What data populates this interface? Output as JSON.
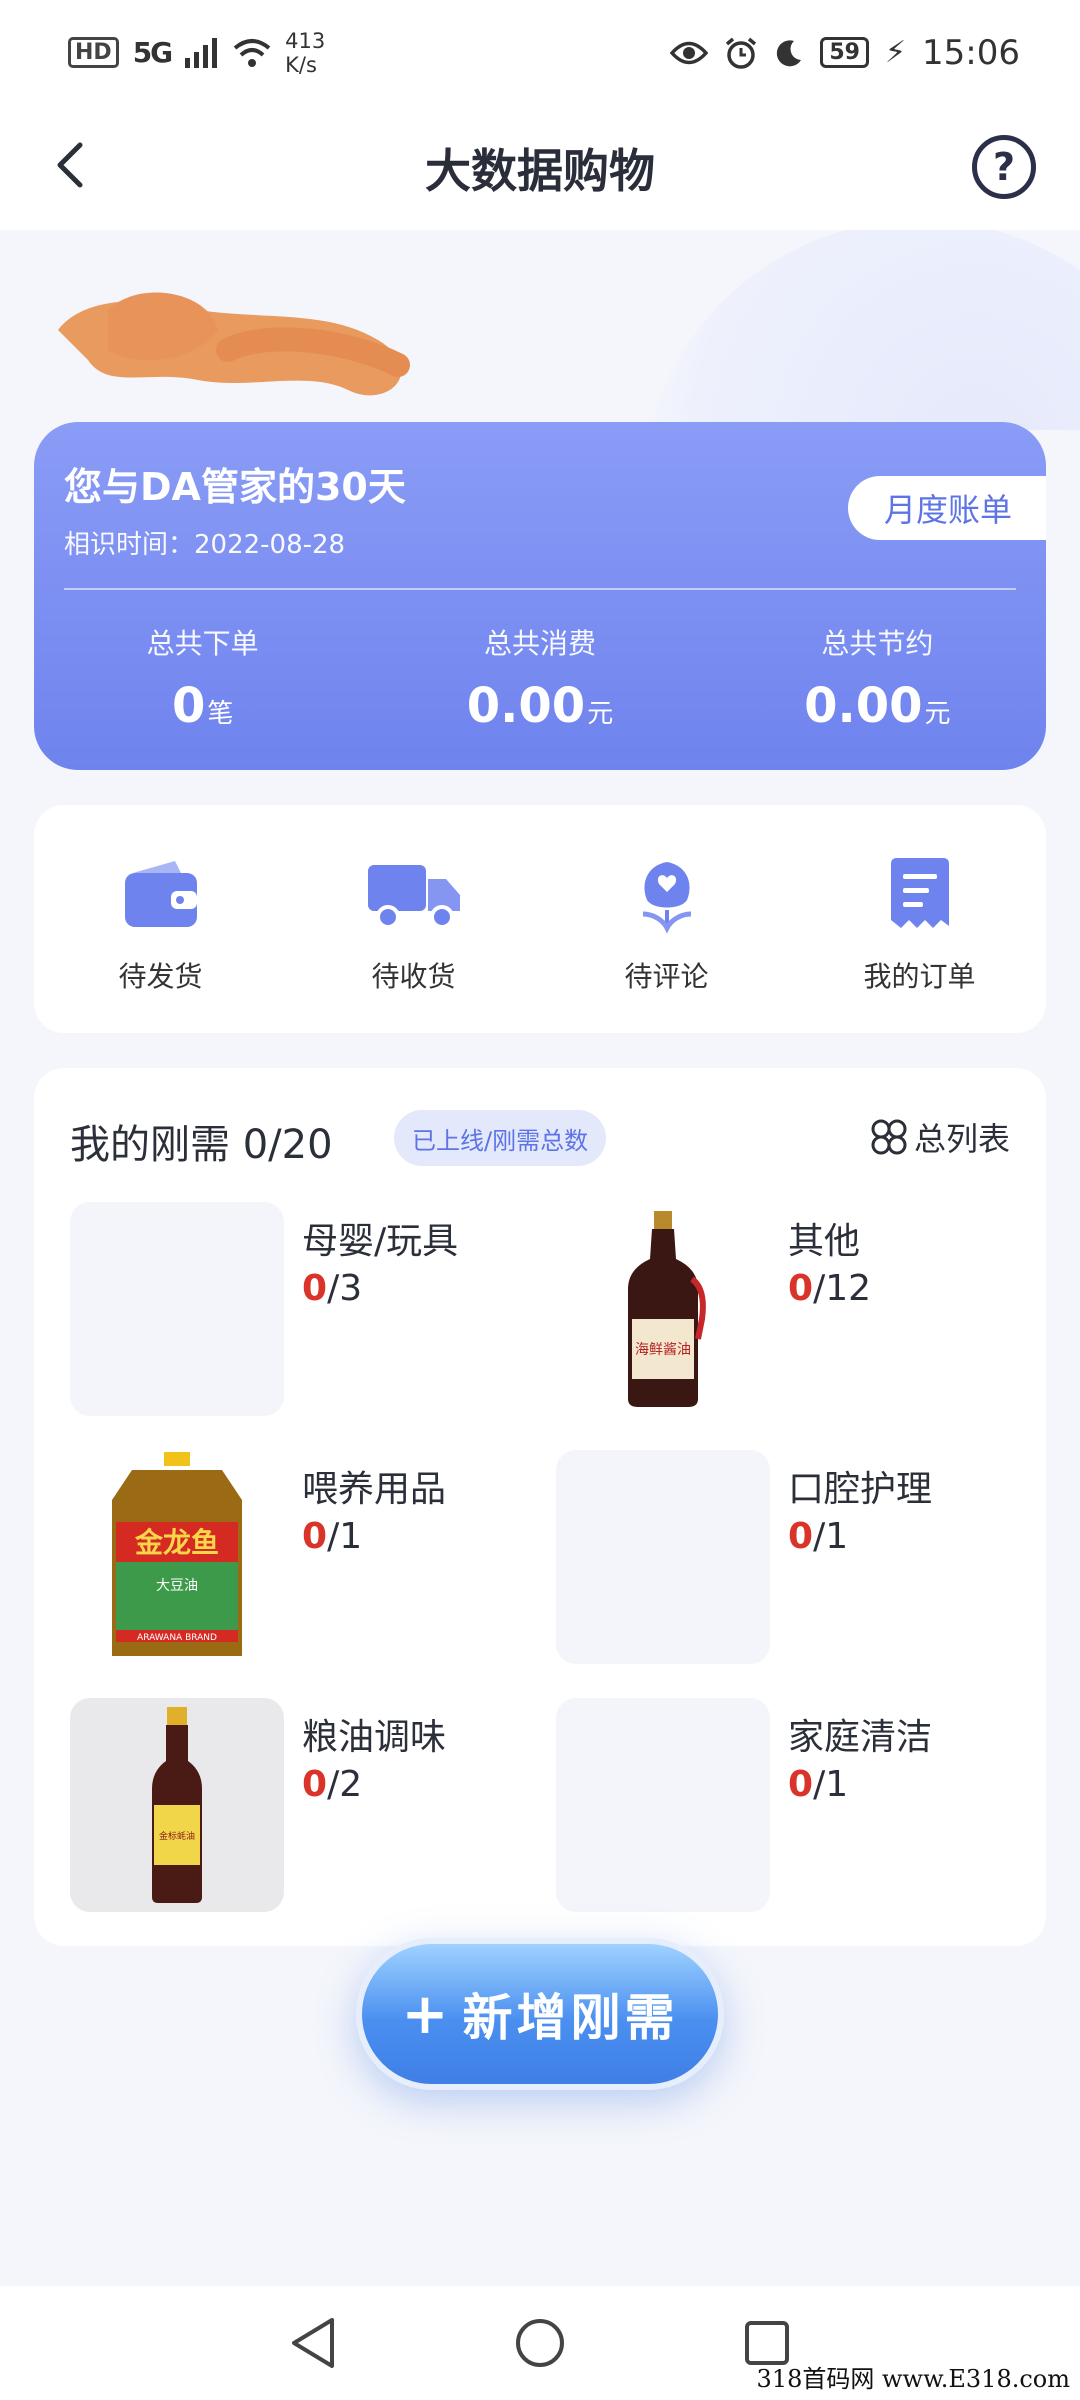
{
  "status_bar": {
    "hd": "HD",
    "network": "5G",
    "speed_value": "413",
    "speed_unit": "K/s",
    "battery": "59",
    "time": "15:06"
  },
  "header": {
    "title": "大数据购物",
    "help": "?"
  },
  "stats": {
    "title": "您与DA管家的30天",
    "since": "相识时间：2022-08-28",
    "monthly_bill": "月度账单",
    "items": [
      {
        "label": "总共下单",
        "value": "0",
        "unit": "笔"
      },
      {
        "label": "总共消费",
        "value": "0.00",
        "unit": "元"
      },
      {
        "label": "总共节约",
        "value": "0.00",
        "unit": "元"
      }
    ]
  },
  "orders": [
    {
      "label": "待发货",
      "icon": "wallet-icon"
    },
    {
      "label": "待收货",
      "icon": "truck-icon"
    },
    {
      "label": "待评论",
      "icon": "flower-heart-icon"
    },
    {
      "label": "我的订单",
      "icon": "order-list-icon"
    }
  ],
  "needs": {
    "title": "我的刚需 0/20",
    "tag": "已上线/刚需总数",
    "list_link": "总列表",
    "items": [
      {
        "name": "母婴/玩具",
        "done": "0",
        "total": "/3"
      },
      {
        "name": "其他",
        "done": "0",
        "total": "/12"
      },
      {
        "name": "喂养用品",
        "done": "0",
        "total": "/1"
      },
      {
        "name": "口腔护理",
        "done": "0",
        "total": "/1"
      },
      {
        "name": "粮油调味",
        "done": "0",
        "total": "/2"
      },
      {
        "name": "家庭清洁",
        "done": "0",
        "total": "/1"
      }
    ]
  },
  "add_button": {
    "plus": "+",
    "label": "新增刚需"
  },
  "product_labels": {
    "soy_sauce": "海鲜酱油",
    "oil_brand": "金龙鱼",
    "oil_type": "大豆油",
    "oil_english": "ARAWANA BRAND",
    "oyster": "金标蚝油"
  },
  "watermark": "318首码网 www.E318.com",
  "colors": {
    "accent": "#6f83ee",
    "progress_done": "#d9332a",
    "background": "#f4f6fb"
  }
}
